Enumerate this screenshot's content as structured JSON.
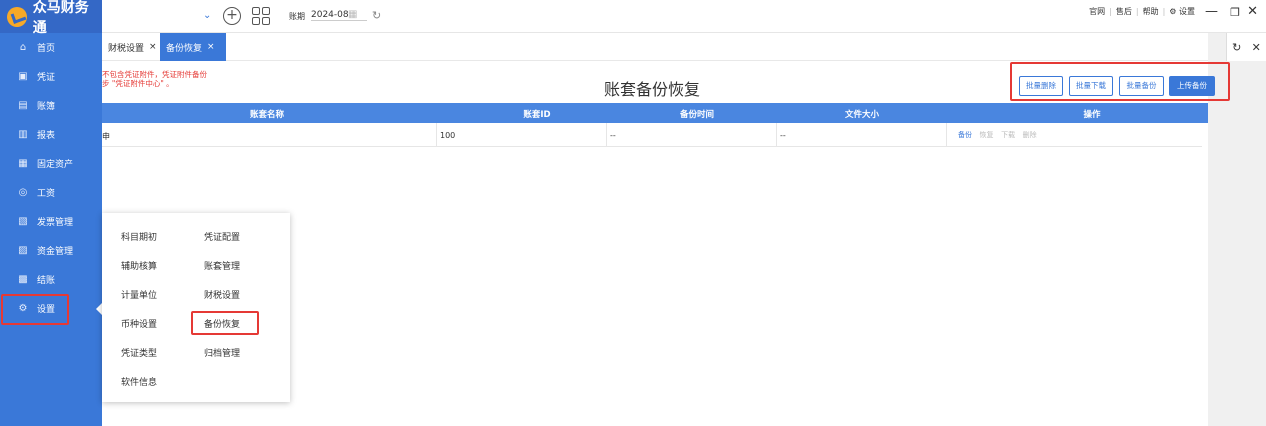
{
  "app": {
    "name": "众马财务通"
  },
  "topbar": {
    "period_label": "账期",
    "period_value": "2024-08",
    "links": [
      "官网",
      "售后",
      "帮助",
      "⚙ 设置"
    ],
    "window_controls": [
      "—",
      "❐",
      "✕"
    ]
  },
  "sidebar": {
    "items": [
      {
        "label": "首页",
        "icon": "home-icon",
        "glyph": "⌂"
      },
      {
        "label": "凭证",
        "icon": "voucher-icon",
        "glyph": "▣"
      },
      {
        "label": "账簿",
        "icon": "ledger-icon",
        "glyph": "▤"
      },
      {
        "label": "报表",
        "icon": "report-icon",
        "glyph": "▥"
      },
      {
        "label": "固定资产",
        "icon": "asset-icon",
        "glyph": "▦"
      },
      {
        "label": "工资",
        "icon": "salary-icon",
        "glyph": "◎"
      },
      {
        "label": "发票管理",
        "icon": "invoice-icon",
        "glyph": "▧"
      },
      {
        "label": "资金管理",
        "icon": "fund-icon",
        "glyph": "▨"
      },
      {
        "label": "结账",
        "icon": "closing-icon",
        "glyph": "▩"
      },
      {
        "label": "设置",
        "icon": "settings-icon",
        "glyph": "⚙"
      }
    ]
  },
  "tabs": [
    {
      "label": "财税设置",
      "close": "×"
    },
    {
      "label": "备份恢复",
      "close": "×"
    }
  ],
  "main": {
    "notice_line1": "不包含凭证附件，凭证附件备份",
    "notice_line2": "步 \"凭证附件中心\" 。",
    "title": "账套备份恢复",
    "buttons": {
      "batch_delete": "批量删除",
      "batch_download": "批量下载",
      "batch_backup": "批量备份",
      "upload_backup": "上传备份"
    }
  },
  "table": {
    "columns": [
      "账套名称",
      "账套ID",
      "备份时间",
      "文件大小",
      "操作"
    ],
    "rows": [
      {
        "name": "申",
        "id": "100",
        "time": "--",
        "size": "--",
        "ops": [
          "备份",
          "恢复",
          "下载",
          "删除"
        ]
      }
    ]
  },
  "menu": {
    "col1": [
      "科目期初",
      "辅助核算",
      "计量单位",
      "币种设置",
      "凭证类型",
      "软件信息"
    ],
    "col2": [
      "凭证配置",
      "账套管理",
      "财税设置",
      "备份恢复",
      "归档管理"
    ]
  },
  "colors": {
    "accent": "#3a78d8",
    "highlight": "#e53935"
  }
}
